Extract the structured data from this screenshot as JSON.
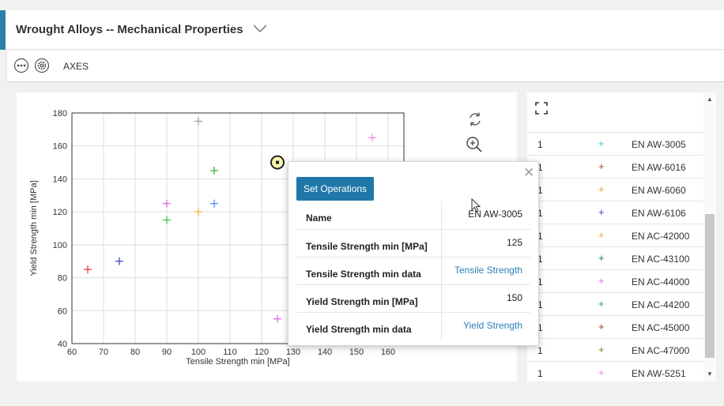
{
  "header": {
    "title": "Wrought Alloys -- Mechanical Properties"
  },
  "toolbar": {
    "more_icon": "more-icon",
    "settings_icon": "settings-icon",
    "axes_label": "AXES"
  },
  "chart_data": {
    "type": "scatter",
    "xlabel": "Tensile Strength min [MPa]",
    "ylabel": "Yield Strength min [MPa]",
    "xlim": [
      60,
      165
    ],
    "ylim": [
      40,
      180
    ],
    "x_ticks": [
      "60",
      "70",
      "80",
      "90",
      "100",
      "110",
      "120",
      "130",
      "140",
      "150",
      "160"
    ],
    "y_ticks": [
      "40",
      "60",
      "80",
      "100",
      "120",
      "140",
      "160",
      "180"
    ],
    "grid": true,
    "points": [
      {
        "x": 65,
        "y": 85,
        "color": "#e8312e"
      },
      {
        "x": 75,
        "y": 90,
        "color": "#3b3bd6"
      },
      {
        "x": 90,
        "y": 125,
        "color": "#e060e0"
      },
      {
        "x": 90,
        "y": 115,
        "color": "#3ac23a"
      },
      {
        "x": 100,
        "y": 120,
        "color": "#f0b030"
      },
      {
        "x": 100,
        "y": 175,
        "color": "#999999"
      },
      {
        "x": 105,
        "y": 125,
        "color": "#4488ee"
      },
      {
        "x": 105,
        "y": 145,
        "color": "#2daa2d"
      },
      {
        "x": 125,
        "y": 150,
        "color": "#6666ff",
        "selected": true
      },
      {
        "x": 125,
        "y": 55,
        "color": "#e060e0"
      },
      {
        "x": 155,
        "y": 165,
        "color": "#ff77ee"
      }
    ]
  },
  "chart_tools": {
    "reset_icon": "refresh-icon",
    "zoom_icon": "zoom-in-icon"
  },
  "list": {
    "expand_icon": "expand-icon",
    "rows": [
      {
        "count": "1",
        "marker": "+",
        "color": "#29c9d6",
        "name": "EN AW-3005"
      },
      {
        "count": "1",
        "marker": "+",
        "color": "#c0392b",
        "name": "EN AW-6016"
      },
      {
        "count": "1",
        "marker": "+",
        "color": "#e0a020",
        "name": "EN AW-6060"
      },
      {
        "count": "1",
        "marker": "+",
        "color": "#3b3bd6",
        "name": "EN AW-6106"
      },
      {
        "count": "1",
        "marker": "+",
        "color": "#f0a030",
        "name": "EN AC-42000"
      },
      {
        "count": "1",
        "marker": "+",
        "color": "#1e7a6a",
        "name": "EN AC-43100"
      },
      {
        "count": "1",
        "marker": "+",
        "color": "#d070e0",
        "name": "EN AC-44000"
      },
      {
        "count": "1",
        "marker": "+",
        "color": "#2a8aa0",
        "name": "EN AC-44200"
      },
      {
        "count": "1",
        "marker": "+",
        "color": "#8a3a1a",
        "name": "EN AC-45000"
      },
      {
        "count": "1",
        "marker": "+",
        "color": "#5a8a2a",
        "name": "EN AC-47000"
      },
      {
        "count": "1",
        "marker": "+",
        "color": "#ff77ee",
        "name": "EN AW-5251"
      }
    ]
  },
  "popup": {
    "button": "Set Operations",
    "rows": [
      {
        "key": "Name",
        "value": "EN AW-3005",
        "link": false
      },
      {
        "key": "Tensile Strength min [MPa]",
        "value": "125",
        "link": false
      },
      {
        "key": "Tensile Strength min data",
        "value": "Tensile Strength",
        "link": true
      },
      {
        "key": "Yield Strength min [MPa]",
        "value": "150",
        "link": false
      },
      {
        "key": "Yield Strength min data",
        "value": "Yield Strength",
        "link": true
      }
    ]
  }
}
